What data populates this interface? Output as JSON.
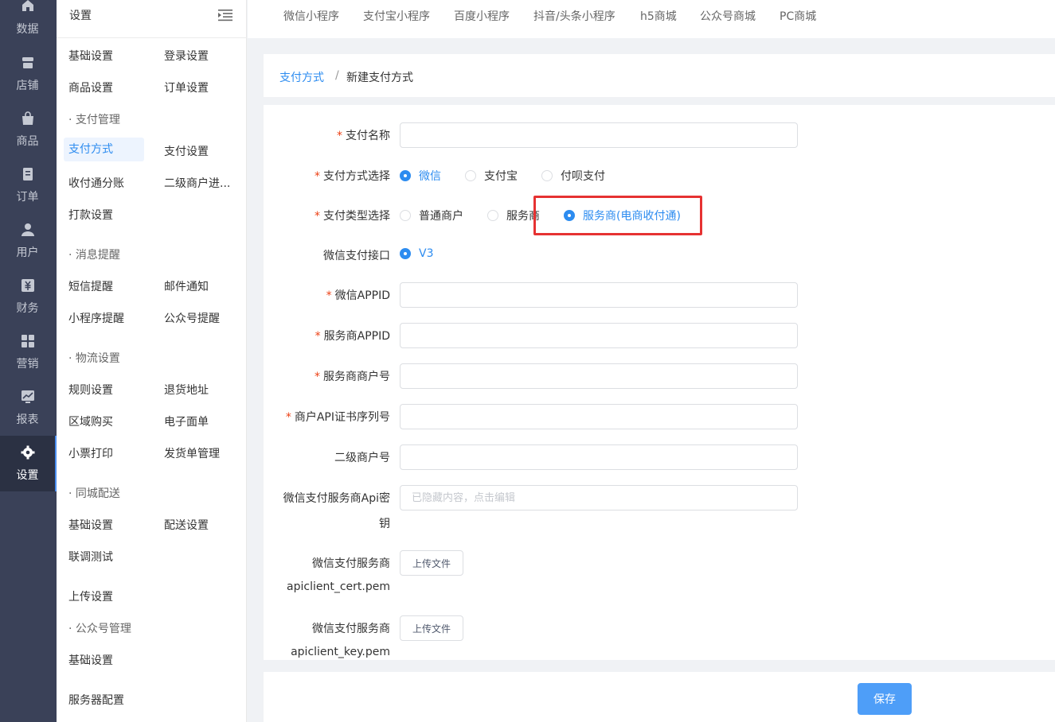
{
  "nav": [
    {
      "label": "数据",
      "icon": "home-icon"
    },
    {
      "label": "店铺",
      "icon": "store-icon"
    },
    {
      "label": "商品",
      "icon": "bag-icon"
    },
    {
      "label": "订单",
      "icon": "order-icon"
    },
    {
      "label": "用户",
      "icon": "user-icon"
    },
    {
      "label": "财务",
      "icon": "finance-icon"
    },
    {
      "label": "营销",
      "icon": "marketing-icon"
    },
    {
      "label": "报表",
      "icon": "chart-icon"
    },
    {
      "label": "设置",
      "icon": "gear-icon"
    }
  ],
  "sub": {
    "title": "设置",
    "items": {
      "basic": "基础设置",
      "login": "登录设置",
      "goods": "商品设置",
      "order": "订单设置",
      "pay_group": "· 支付管理",
      "pay_method": "支付方式",
      "pay_settings": "支付设置",
      "split": "收付通分账",
      "sub_merchant": "二级商户进...",
      "transfer": "打款设置",
      "msg_group": "· 消息提醒",
      "sms": "短信提醒",
      "mail": "邮件通知",
      "mini_notify": "小程序提醒",
      "mp_notify": "公众号提醒",
      "logistics_group": "· 物流设置",
      "rules": "规则设置",
      "return_addr": "退货地址",
      "region": "区域购买",
      "e_waybill": "电子面单",
      "receipt": "小票打印",
      "ship_mgr": "发货单管理",
      "city_group": "· 同城配送",
      "city_basic": "基础设置",
      "delivery": "配送设置",
      "joint_test": "联调测试",
      "upload": "上传设置",
      "mp_group": "· 公众号管理",
      "mp_basic": "基础设置",
      "server": "服务器配置"
    }
  },
  "tabs": [
    "微信小程序",
    "支付宝小程序",
    "百度小程序",
    "抖音/头条小程序",
    "h5商城",
    "公众号商城",
    "PC商城"
  ],
  "breadcrumb": {
    "parent": "支付方式",
    "sep": "/",
    "current": "新建支付方式"
  },
  "form": {
    "pay_name_label": "支付名称",
    "method_label": "支付方式选择",
    "methods": [
      "微信",
      "支付宝",
      "付呗支付"
    ],
    "type_label": "支付类型选择",
    "types": [
      "普通商户",
      "服务商",
      "服务商(电商收付通)"
    ],
    "api_label": "微信支付接口",
    "api_value": "V3",
    "wx_appid_label": "微信APPID",
    "sp_appid_label": "服务商APPID",
    "sp_mchid_label": "服务商商户号",
    "cert_serial_label": "商户API证书序列号",
    "sub_mchid_label": "二级商户号",
    "apikey_label_1": "微信支付服务商Api密",
    "apikey_label_2": "钥",
    "apikey_placeholder": "已隐藏内容，点击编辑",
    "cert_label_1": "微信支付服务商",
    "cert_label_2": "apiclient_cert.pem",
    "key_label_1": "微信支付服务商",
    "key_label_2": "apiclient_key.pem",
    "upload_label": "上传文件",
    "required_mark": "*"
  },
  "footer": {
    "save": "保存"
  },
  "colors": {
    "nav_bg": "#3a4158",
    "accent": "#2d8cf0",
    "required": "#ed4014",
    "highlight": "#e63232",
    "save_bg": "#4e9ef8"
  }
}
